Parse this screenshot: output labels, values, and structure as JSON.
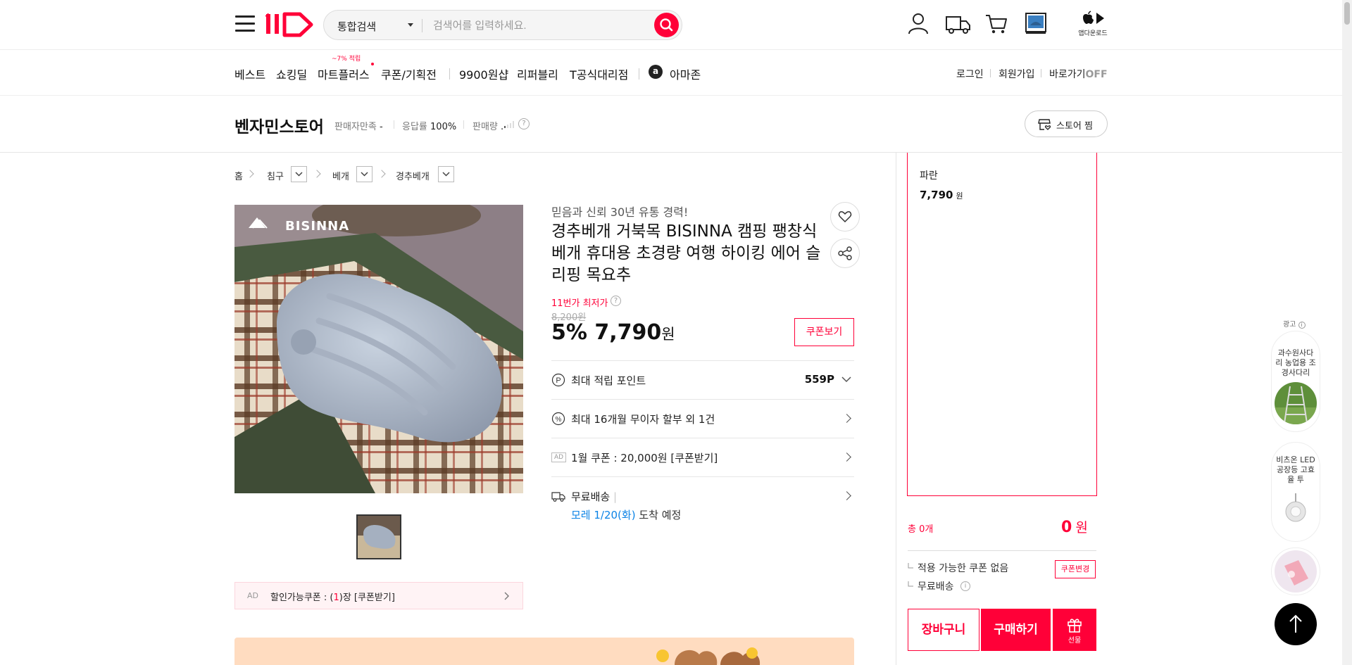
{
  "header": {
    "search_category": "통합검색",
    "search_placeholder": "검색어를 입력하세요.",
    "app_download": "앱다운로드"
  },
  "nav": {
    "items": [
      "베스트",
      "쇼킹딜",
      "마트플러스",
      "쿠폰/기획전",
      "9900원샵",
      "리퍼블리",
      "T공식대리점",
      "아마존"
    ],
    "promo_badge": "~7% 적립",
    "amazon_icon": "a",
    "right": {
      "login": "로그인",
      "signup": "회원가입",
      "shortcut": "바로가기",
      "shortcut_state": "OFF"
    }
  },
  "store": {
    "name": "벤자민스토어",
    "satisfaction_label": "판매자만족",
    "satisfaction_value": "-",
    "response_label": "응답률",
    "response_value": "100%",
    "sales_label": "판매량",
    "sales_value": ".",
    "fav_button": "스토어 찜"
  },
  "breadcrumb": [
    "홈",
    "침구",
    "베개",
    "경추베개"
  ],
  "product": {
    "brand_overlay": "BISINNA",
    "tagline": "믿음과 신뢰 30년 유통 경력!",
    "title": "경추베개 거북목 BISINNA 캠핑 팽창식 베개 휴대용 초경량 여행 하이킹 에어 슬리핑 목요추",
    "lowest_label": "11번가 최저가",
    "original_price": "8,200원",
    "discount": "5%",
    "price": "7,790",
    "price_unit": "원",
    "coupon_view": "쿠폰보기",
    "rows": [
      {
        "label": "최대 적립 포인트",
        "value": "559P"
      },
      {
        "label": "최대 16개월 무이자 할부 외 1건"
      },
      {
        "label": "1월 쿠폰 : 20,000원 [쿠폰받기]",
        "tag": "AD"
      },
      {
        "label": "무료배송",
        "sep": "|",
        "arrival_date": "모레 1/20(화)",
        "arrival_suffix": "도착 예정"
      }
    ],
    "coupon_bar": {
      "ad": "AD",
      "prefix": "할인가능쿠폰 : (",
      "count": "1",
      "suffix": ")장 [쿠폰받기]"
    }
  },
  "sidebar": {
    "option_name": "파란",
    "option_price": "7,790",
    "option_unit": "원",
    "total_label": "총 0개",
    "total_value": "0",
    "total_unit": "원",
    "coupon_status": "적용 가능한 쿠폰 없음",
    "coupon_change": "쿠폰변경",
    "shipping": "무료배송",
    "cart": "장바구니",
    "buy": "구매하기",
    "gift": "선물"
  },
  "ads": {
    "label": "광고",
    "cards": [
      "과수원사다리 농업용 조경사다리",
      "비츠온 LED공장등 고효율 투"
    ]
  },
  "colors": {
    "brand": "#ff0038",
    "link_blue": "#0b83e6"
  }
}
